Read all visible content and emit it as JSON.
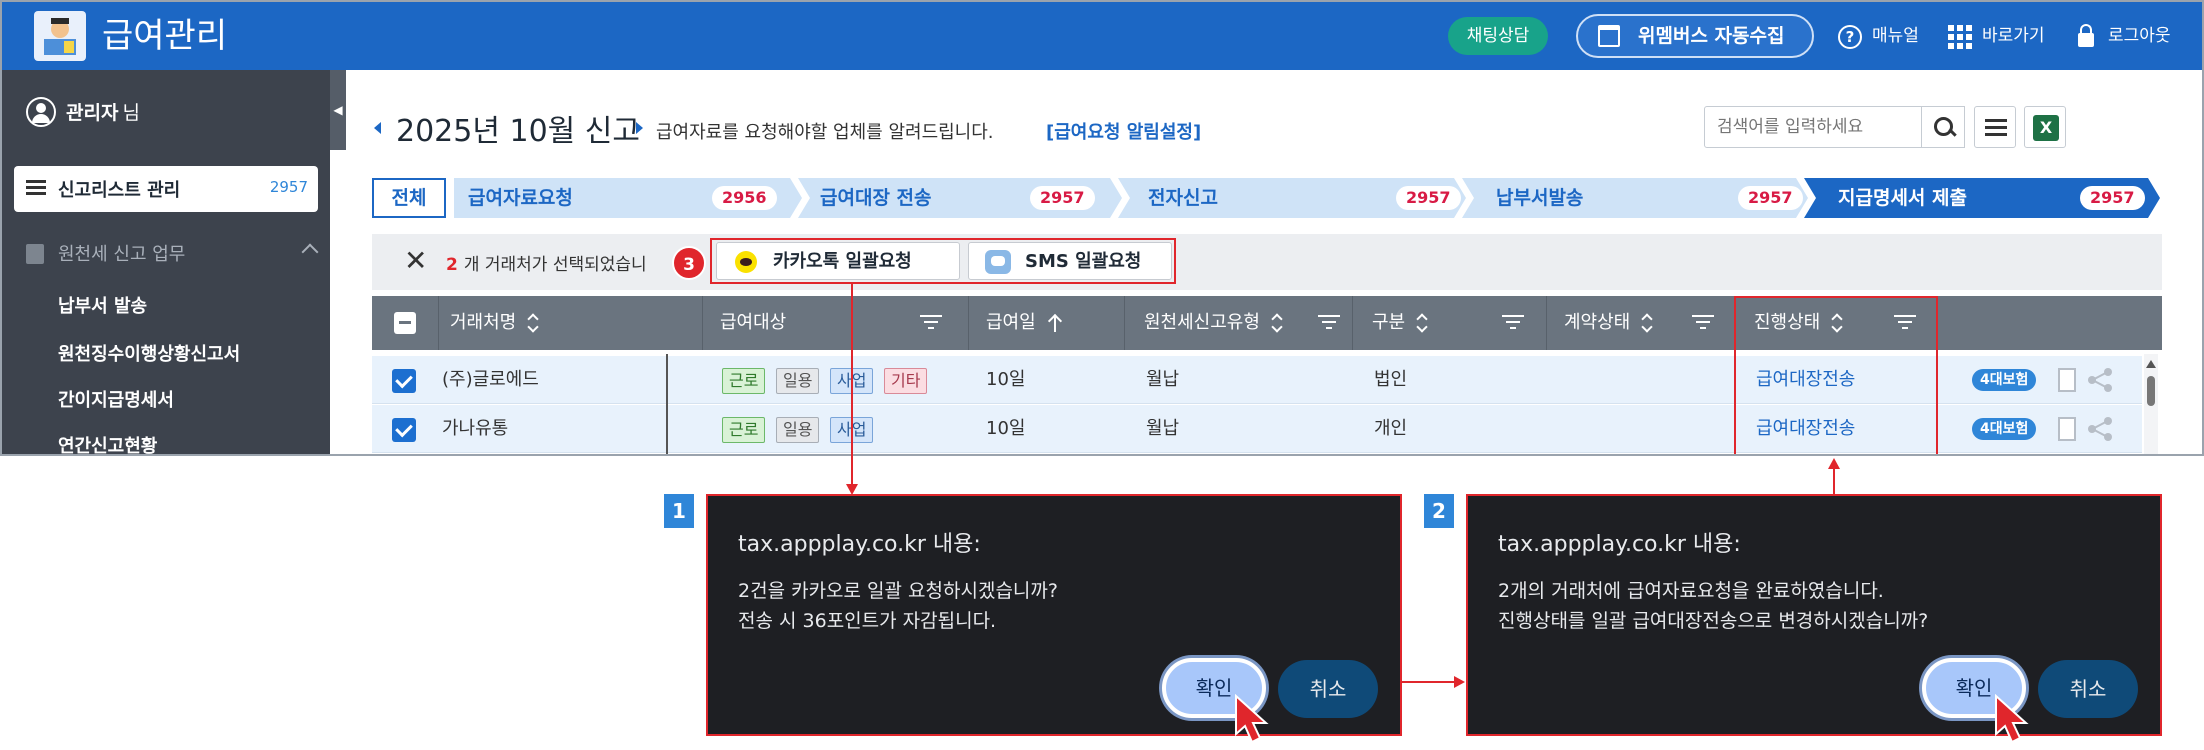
{
  "header": {
    "title": "급여관리",
    "chat_label": "채팅상담",
    "wemembers_label": "위멤버스 자동수집",
    "manual_label": "매뉴얼",
    "shortcut_label": "바로가기",
    "logout_label": "로그아웃"
  },
  "sidebar": {
    "user_name": "관리자",
    "user_suffix": "님",
    "active_item": {
      "label": "신고리스트 관리",
      "count": "2957"
    },
    "group_label": "원천세 신고 업무",
    "sub_items": [
      "납부서 발송",
      "원천징수이행상황신고서",
      "간이지급명세서",
      "연간신고현황"
    ]
  },
  "main": {
    "period": "2025년 10월 신고",
    "desc": "급여자료를 요청해야할 업체를 알려드립니다.",
    "alarm_link": "[급여요청 알림설정]",
    "search_placeholder": "검색어를 입력하세요",
    "excel_icon": "X"
  },
  "steps": {
    "all_label": "전체",
    "items": [
      {
        "label": "급여자료요청",
        "count": "2956"
      },
      {
        "label": "급여대장 전송",
        "count": "2957"
      },
      {
        "label": "전자신고",
        "count": "2957"
      },
      {
        "label": "납부서발송",
        "count": "2957"
      },
      {
        "label": "지급명세서 제출",
        "count": "2957"
      }
    ]
  },
  "selection": {
    "count": "2",
    "text": "개 거래처가 선택되었습니",
    "close": "✕",
    "kakao_label": "카카오톡 일괄요청",
    "sms_label": "SMS 일괄요청"
  },
  "table": {
    "columns": [
      "거래처명",
      "급여대상",
      "급여일",
      "원천세신고유형",
      "구분",
      "계약상태",
      "진행상태"
    ],
    "rows": [
      {
        "name": "(주)글로에드",
        "tags": [
          "근로",
          "일용",
          "사업",
          "기타"
        ],
        "pay_day": "10일",
        "report_type": "월납",
        "kind": "법인",
        "status": "급여대장전송",
        "insurance": "4대보험"
      },
      {
        "name": "가나유통",
        "tags": [
          "근로",
          "일용",
          "사업"
        ],
        "pay_day": "10일",
        "report_type": "월납",
        "kind": "개인",
        "status": "급여대장전송",
        "insurance": "4대보험"
      }
    ]
  },
  "annotations": {
    "badge_1": "1",
    "badge_2": "2",
    "badge_3": "3"
  },
  "dialog1": {
    "title": "tax.appplay.co.kr 내용:",
    "line1": "2건을 카카오로 일괄 요청하시겠습니까?",
    "line2": "전송 시 36포인트가 자감됩니다.",
    "ok": "확인",
    "cancel": "취소"
  },
  "dialog2": {
    "title": "tax.appplay.co.kr 내용:",
    "line1": "2개의 거래처에 급여자료요청을 완료하였습니다.",
    "line2": "진행상태를 일괄 급여대장전송으로 변경하시겠습니까?",
    "ok": "확인",
    "cancel": "취소"
  },
  "colors": {
    "header": "#1c67c4",
    "sidebar": "#3d434d",
    "accent_red": "#e0262c",
    "step_dark": "#1c67c4",
    "step_light": "#cfe3f7"
  }
}
